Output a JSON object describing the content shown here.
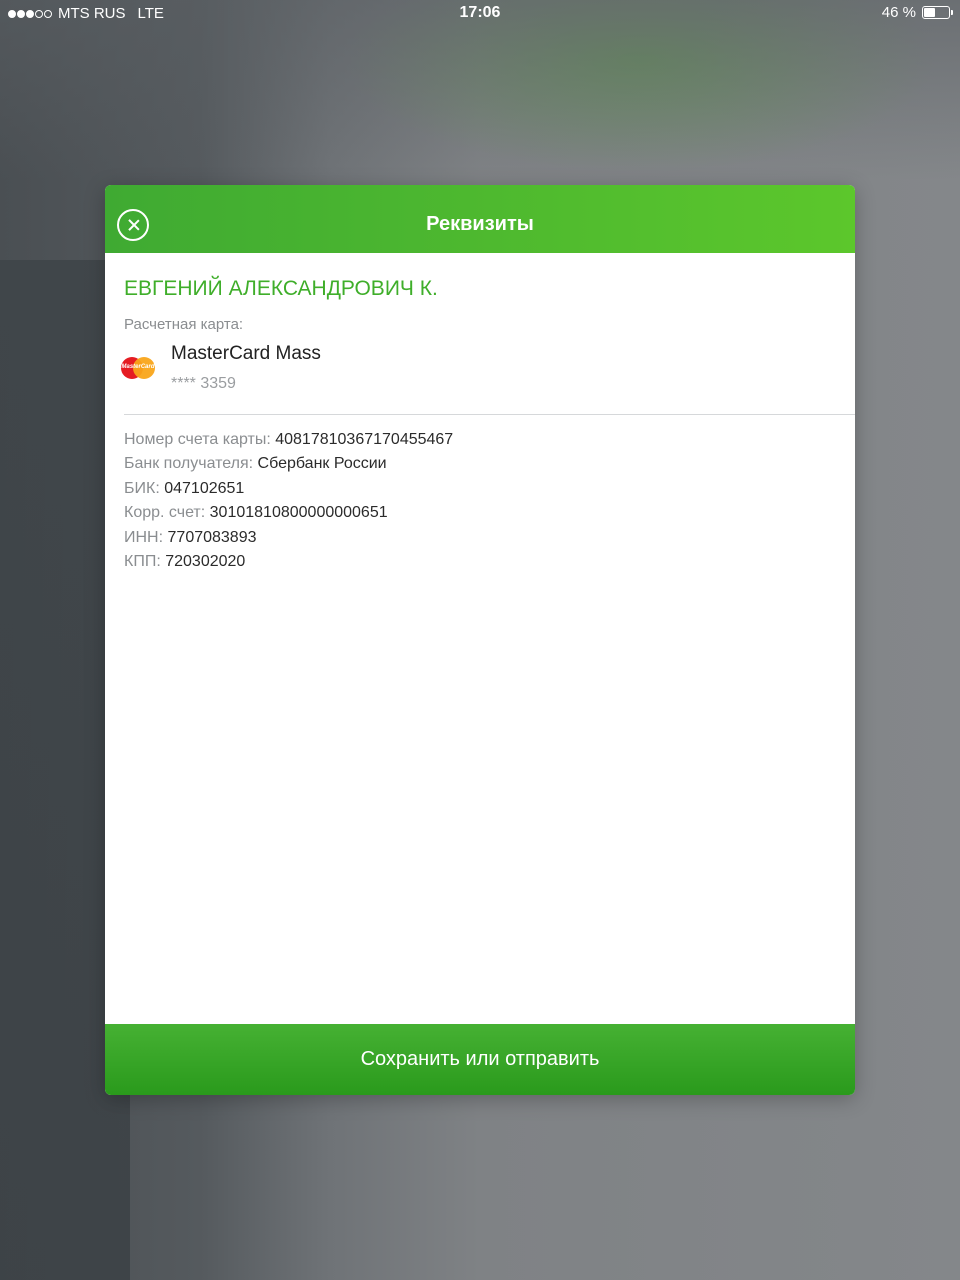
{
  "status_bar": {
    "carrier": "MTS RUS",
    "network": "LTE",
    "time": "17:06",
    "battery": "46 %",
    "battery_level": 0.46,
    "signal_bars": 3,
    "signal_max": 5
  },
  "modal": {
    "title": "Реквизиты",
    "payee_name": "ЕВГЕНИЙ АЛЕКСАНДРОВИЧ К.",
    "card_section_label": "Расчетная карта:",
    "card": {
      "logo_icon": "mastercard-logo",
      "logo_text": "MasterCard",
      "name": "MasterCard Mass",
      "number": "**** 3359"
    },
    "details": [
      {
        "label": "Номер счета карты:",
        "value": "40817810367170455467"
      },
      {
        "label": "Банк получателя:",
        "value": "Сбербанк России"
      },
      {
        "label": "БИК:",
        "value": "047102651"
      },
      {
        "label": "Корр. счет:",
        "value": "30101810800000000651"
      },
      {
        "label": "ИНН:",
        "value": "7707083893"
      },
      {
        "label": "КПП:",
        "value": "720302020"
      }
    ],
    "action_label": "Сохранить или отправить"
  },
  "colors": {
    "accent_green": "#3fae2a",
    "header_green": "#5cc72c",
    "button_green": "#2a9a1c"
  }
}
